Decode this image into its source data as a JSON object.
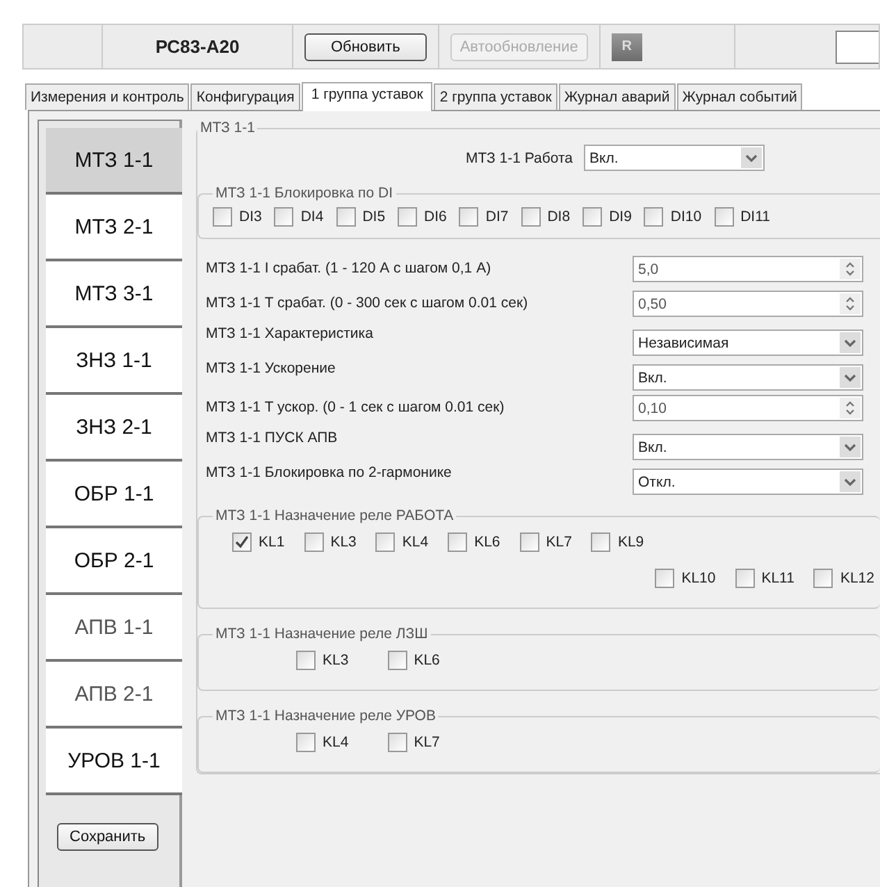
{
  "toolbar": {
    "device": "РС83-А20",
    "buttons": [
      {
        "label": "Обновить",
        "disabled": false
      },
      {
        "label": "Автообновление",
        "disabled": true
      }
    ],
    "indicator": "R"
  },
  "tabs": [
    {
      "label": "Измерения и контроль",
      "selected": false
    },
    {
      "label": "Конфигурация",
      "selected": false
    },
    {
      "label": "1 группа уставок",
      "selected": true
    },
    {
      "label": "2 группа уставок",
      "selected": false
    },
    {
      "label": "Журнал аварий",
      "selected": false
    },
    {
      "label": "Журнал событий",
      "selected": false
    }
  ],
  "sidebar": {
    "items": [
      {
        "label": "МТЗ 1-1",
        "selected": true,
        "disabled": false
      },
      {
        "label": "МТЗ 2-1",
        "selected": false,
        "disabled": false
      },
      {
        "label": "МТЗ 3-1",
        "selected": false,
        "disabled": false
      },
      {
        "label": "ЗНЗ 1-1",
        "selected": false,
        "disabled": false
      },
      {
        "label": "ЗНЗ 2-1",
        "selected": false,
        "disabled": false
      },
      {
        "label": "ОБР 1-1",
        "selected": false,
        "disabled": false
      },
      {
        "label": "ОБР 2-1",
        "selected": false,
        "disabled": false
      },
      {
        "label": "АПВ 1-1",
        "selected": false,
        "disabled": true
      },
      {
        "label": "АПВ 2-1",
        "selected": false,
        "disabled": true
      },
      {
        "label": "УРОВ 1-1",
        "selected": false,
        "disabled": false
      }
    ],
    "save_button": "Сохранить"
  },
  "group": {
    "title": "МТЗ 1-1",
    "work_label": "МТЗ 1-1 Работа",
    "work_value": "Вкл.",
    "di_block": {
      "title": "МТЗ 1-1 Блокировка по DI",
      "items": [
        {
          "label": "DI3",
          "checked": false
        },
        {
          "label": "DI4",
          "checked": false
        },
        {
          "label": "DI5",
          "checked": false
        },
        {
          "label": "DI6",
          "checked": false
        },
        {
          "label": "DI7",
          "checked": false
        },
        {
          "label": "DI8",
          "checked": false
        },
        {
          "label": "DI9",
          "checked": false
        },
        {
          "label": "DI10",
          "checked": false
        },
        {
          "label": "DI11",
          "checked": false
        }
      ]
    },
    "rows": [
      {
        "label": "МТЗ 1-1 I срабат. (1 -  120 А с шагом 0,1 А)",
        "kind": "spin",
        "value": "5,0"
      },
      {
        "label": "МТЗ 1-1 T срабат. (0 - 300 сек с шагом 0.01 сек)",
        "kind": "spin",
        "value": "0,50"
      },
      {
        "label": "МТЗ 1-1 Характеристика",
        "kind": "combo",
        "value": "Независимая"
      },
      {
        "label": "МТЗ 1-1 Ускорение",
        "kind": "combo",
        "value": "Вкл."
      },
      {
        "label": "МТЗ 1-1 T ускор. (0 - 1 сек с шагом 0.01 сек)",
        "kind": "spin",
        "value": "0,10"
      },
      {
        "label": "МТЗ 1-1 ПУСК АПВ",
        "kind": "combo",
        "value": "Вкл."
      },
      {
        "label": "МТЗ 1-1 Блокировка по 2-гармонике",
        "kind": "combo",
        "value": "Откл."
      }
    ],
    "relay_groups": [
      {
        "title": "МТЗ 1-1 Назначение реле РАБОТА",
        "lines": [
          [
            {
              "label": "KL1",
              "checked": true
            },
            {
              "label": "KL3",
              "checked": false
            },
            {
              "label": "KL4",
              "checked": false
            },
            {
              "label": "KL6",
              "checked": false
            },
            {
              "label": "KL7",
              "checked": false
            },
            {
              "label": "KL9",
              "checked": false
            }
          ],
          [
            {
              "label": "KL10",
              "checked": false
            },
            {
              "label": "KL11",
              "checked": false
            },
            {
              "label": "KL12",
              "checked": false
            }
          ]
        ]
      },
      {
        "title": "МТЗ 1-1 Назначение реле ЛЗШ",
        "lines": [
          [
            {
              "label": "KL3",
              "checked": false
            },
            {
              "label": "KL6",
              "checked": false
            }
          ]
        ]
      },
      {
        "title": "МТЗ 1-1 Назначение реле УРОВ",
        "lines": [
          [
            {
              "label": "KL4",
              "checked": false
            },
            {
              "label": "KL7",
              "checked": false
            }
          ]
        ]
      }
    ]
  }
}
